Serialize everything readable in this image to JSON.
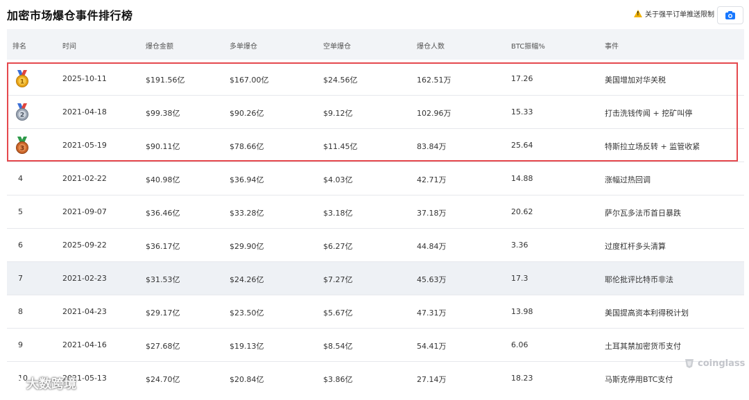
{
  "page": {
    "title": "加密市场爆仓事件排行榜",
    "notice": "关于强平订单推送限制",
    "camera_icon": "camera-icon",
    "accent_color": "#1677ff",
    "highlight_box_color": "#e5484d"
  },
  "table": {
    "headers": [
      "排名",
      "时间",
      "爆仓金额",
      "多单爆仓",
      "空单爆仓",
      "爆仓人数",
      "BTC振幅%",
      "事件"
    ],
    "rows": [
      {
        "rank": "1",
        "medal": "gold-medal-icon",
        "date": "2025-10-11",
        "total": "$191.56亿",
        "long": "$167.00亿",
        "short": "$24.56亿",
        "people": "162.51万",
        "btc": "17.26",
        "event": "美国增加对华关税"
      },
      {
        "rank": "2",
        "medal": "silver-medal-icon",
        "date": "2021-04-18",
        "total": "$99.38亿",
        "long": "$90.26亿",
        "short": "$9.12亿",
        "people": "102.96万",
        "btc": "15.33",
        "event": "打击洗钱传闻 + 挖矿叫停"
      },
      {
        "rank": "3",
        "medal": "bronze-medal-icon",
        "date": "2021-05-19",
        "total": "$90.11亿",
        "long": "$78.66亿",
        "short": "$11.45亿",
        "people": "83.84万",
        "btc": "25.64",
        "event": "特斯拉立场反转 + 监管收紧"
      },
      {
        "rank": "4",
        "date": "2021-02-22",
        "total": "$40.98亿",
        "long": "$36.94亿",
        "short": "$4.03亿",
        "people": "42.71万",
        "btc": "14.88",
        "event": "涨幅过热回调"
      },
      {
        "rank": "5",
        "date": "2021-09-07",
        "total": "$36.46亿",
        "long": "$33.28亿",
        "short": "$3.18亿",
        "people": "37.18万",
        "btc": "20.62",
        "event": "萨尔瓦多法币首日暴跌"
      },
      {
        "rank": "6",
        "date": "2025-09-22",
        "total": "$36.17亿",
        "long": "$29.90亿",
        "short": "$6.27亿",
        "people": "44.84万",
        "btc": "3.36",
        "event": "过度杠杆多头清算"
      },
      {
        "rank": "7",
        "date": "2021-02-23",
        "total": "$31.53亿",
        "long": "$24.26亿",
        "short": "$7.27亿",
        "people": "45.63万",
        "btc": "17.3",
        "event": "耶伦批评比特币非法"
      },
      {
        "rank": "8",
        "date": "2021-04-23",
        "total": "$29.17亿",
        "long": "$23.50亿",
        "short": "$5.67亿",
        "people": "47.31万",
        "btc": "13.98",
        "event": "美国提高资本利得税计划"
      },
      {
        "rank": "9",
        "date": "2021-04-16",
        "total": "$27.68亿",
        "long": "$19.13亿",
        "short": "$8.54亿",
        "people": "54.41万",
        "btc": "6.06",
        "event": "土耳其禁加密货币支付"
      },
      {
        "rank": "10",
        "date": "2021-05-13",
        "total": "$24.70亿",
        "long": "$20.84亿",
        "short": "$3.86亿",
        "people": "27.14万",
        "btc": "18.23",
        "event": "马斯克停用BTC支付"
      }
    ]
  },
  "watermarks": {
    "coinglass": "coinglass",
    "dashuju": "大数跨境"
  }
}
